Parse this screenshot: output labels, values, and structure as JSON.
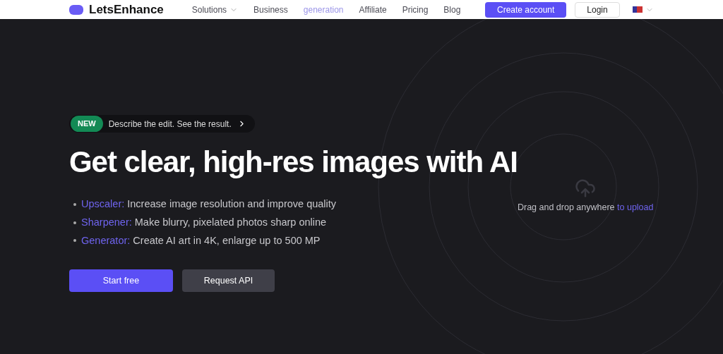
{
  "header": {
    "logo": "LetsEnhance",
    "nav": [
      {
        "label": "Solutions",
        "dropdown": true,
        "highlighted": false
      },
      {
        "label": "Business",
        "dropdown": false,
        "highlighted": false
      },
      {
        "label": "generation",
        "dropdown": false,
        "highlighted": true
      },
      {
        "label": "Affiliate",
        "dropdown": false,
        "highlighted": false
      },
      {
        "label": "Pricing",
        "dropdown": false,
        "highlighted": false
      },
      {
        "label": "Blog",
        "dropdown": false,
        "highlighted": false
      }
    ],
    "create_account": "Create account",
    "login": "Login"
  },
  "hero": {
    "badge": {
      "tag": "NEW",
      "text": "Describe the edit. See the result."
    },
    "title": "Get clear, high-res images with AI",
    "features": [
      {
        "name": "Upscaler:",
        "text": "Increase image resolution and improve quality"
      },
      {
        "name": "Sharpener:",
        "text": "Make blurry, pixelated photos sharp online"
      },
      {
        "name": "Generator:",
        "text": "Create AI art in 4K, enlarge up to 500 MP"
      }
    ],
    "buttons": [
      {
        "label": "Start free",
        "kind": "primary"
      },
      {
        "label": "Request API",
        "kind": "secondary"
      }
    ]
  },
  "upload": {
    "text": "Drag and drop anywhere",
    "link": "to upload"
  }
}
